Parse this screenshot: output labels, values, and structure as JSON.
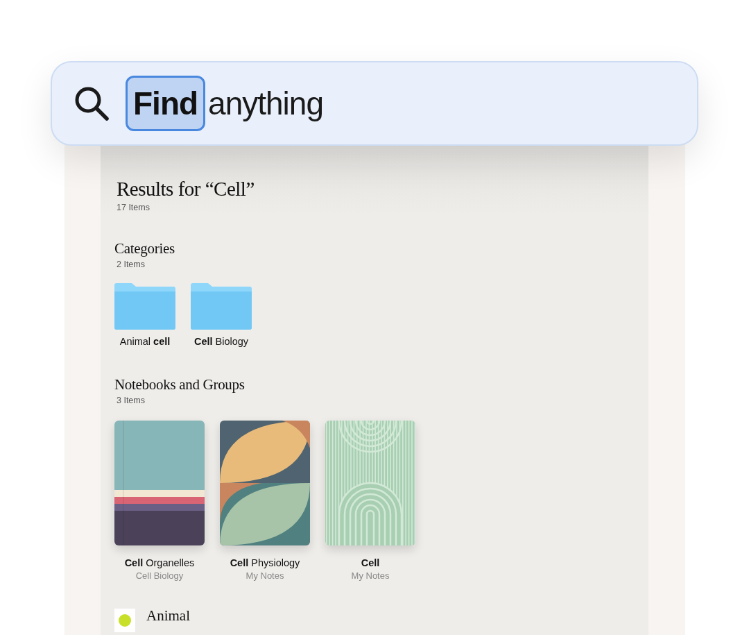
{
  "search": {
    "selected_text": "Find",
    "rest_text": "anything"
  },
  "results": {
    "title": "Results for “Cell”",
    "count": "17 Items"
  },
  "categories": {
    "heading": "Categories",
    "count": "2 Items",
    "items": [
      {
        "label": "Animal **cell**"
      },
      {
        "label": "**Cell** Biology"
      }
    ]
  },
  "notebooks": {
    "heading": "Notebooks and Groups",
    "count": "3 Items",
    "items": [
      {
        "kind": "stripes",
        "title": "**Cell** Organelles",
        "subtitle": "Cell Biology"
      },
      {
        "kind": "leaves",
        "title": "**Cell** Physiology",
        "subtitle": "My Notes"
      },
      {
        "kind": "arches",
        "title": "**Cell**",
        "subtitle": "My Notes"
      }
    ]
  },
  "pages": [
    {
      "title": "Animal"
    }
  ]
}
